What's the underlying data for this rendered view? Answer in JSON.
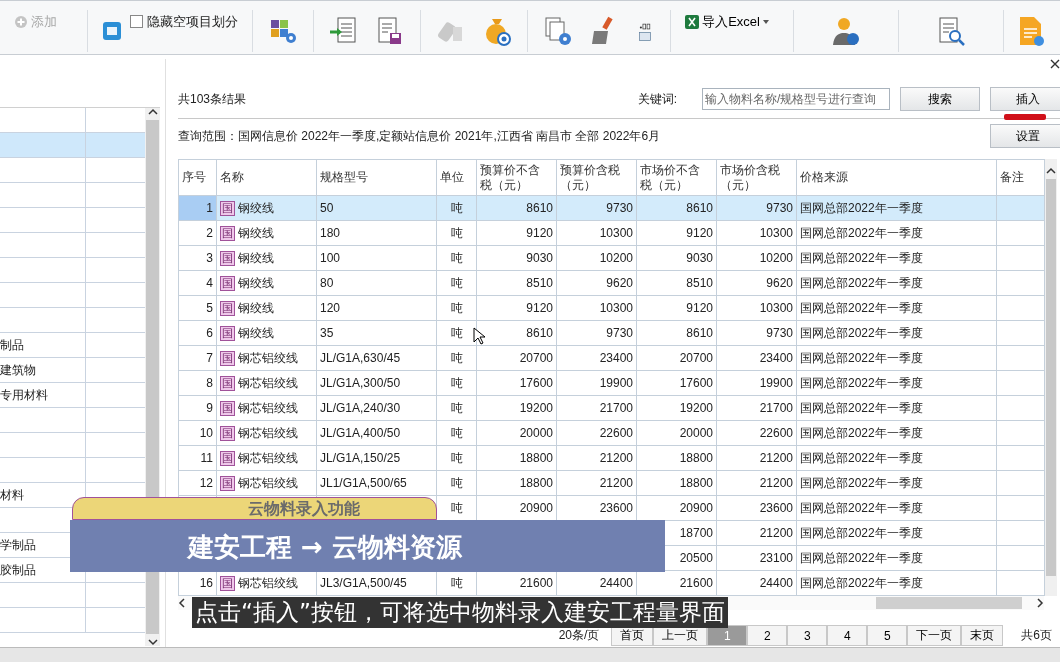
{
  "ribbon": {
    "add_button": {
      "label": "添加",
      "disabled": true
    },
    "hide_empty": {
      "label": "隐藏空项目划分",
      "checked": false
    },
    "import_excel": {
      "label": "导入Excel"
    }
  },
  "sidebar": {
    "rows": [
      {
        "selected": false
      },
      {
        "selected": true
      },
      {
        "selected": false
      },
      {
        "selected": false
      },
      {
        "selected": false
      },
      {
        "selected": false
      },
      {
        "selected": false
      },
      {
        "selected": false
      },
      {
        "selected": false
      },
      {
        "label": "制品",
        "selected": false
      },
      {
        "label": "建筑物",
        "selected": false
      },
      {
        "label": "专用材料",
        "selected": false
      },
      {
        "selected": false
      },
      {
        "selected": false
      },
      {
        "selected": false
      },
      {
        "label": "材料",
        "selected": false
      },
      {
        "selected": false
      },
      {
        "label": "学制品",
        "selected": false
      },
      {
        "label": "胶制品",
        "selected": false
      },
      {
        "selected": false
      },
      {
        "selected": false
      }
    ]
  },
  "dialog": {
    "result_count": "共103条结果",
    "keyword_label": "关键词:",
    "search_placeholder": "输入物料名称/规格型号进行查询",
    "search_button": "搜索",
    "insert_button": "插入",
    "settings_button": "设置",
    "query_scope": "查询范围：国网信息价 2022年一季度,定额站信息价 2021年,江西省 南昌市 全部 2022年6月",
    "table": {
      "columns": [
        "序号",
        "名称",
        "规格型号",
        "单位",
        "预算价不含税（元）",
        "预算价含税（元）",
        "市场价不含税（元）",
        "市场价含税（元）",
        "价格来源",
        "备注"
      ],
      "rows": [
        {
          "no": "1",
          "tag": "国",
          "name": "钢绞线",
          "spec": "50",
          "unit": "吨",
          "budget_ex_tax": "8610",
          "budget_inc_tax": "9730",
          "market_ex_tax": "8610",
          "market_inc_tax": "9730",
          "source": "国网总部2022年一季度",
          "selected": true
        },
        {
          "no": "2",
          "tag": "国",
          "name": "钢绞线",
          "spec": "180",
          "unit": "吨",
          "budget_ex_tax": "9120",
          "budget_inc_tax": "10300",
          "market_ex_tax": "9120",
          "market_inc_tax": "10300",
          "source": "国网总部2022年一季度",
          "selected": false
        },
        {
          "no": "3",
          "tag": "国",
          "name": "钢绞线",
          "spec": "100",
          "unit": "吨",
          "budget_ex_tax": "9030",
          "budget_inc_tax": "10200",
          "market_ex_tax": "9030",
          "market_inc_tax": "10200",
          "source": "国网总部2022年一季度",
          "selected": false
        },
        {
          "no": "4",
          "tag": "国",
          "name": "钢绞线",
          "spec": "80",
          "unit": "吨",
          "budget_ex_tax": "8510",
          "budget_inc_tax": "9620",
          "market_ex_tax": "8510",
          "market_inc_tax": "9620",
          "source": "国网总部2022年一季度",
          "selected": false
        },
        {
          "no": "5",
          "tag": "国",
          "name": "钢绞线",
          "spec": "120",
          "unit": "吨",
          "budget_ex_tax": "9120",
          "budget_inc_tax": "10300",
          "market_ex_tax": "9120",
          "market_inc_tax": "10300",
          "source": "国网总部2022年一季度",
          "selected": false
        },
        {
          "no": "6",
          "tag": "国",
          "name": "钢绞线",
          "spec": "35",
          "unit": "吨",
          "budget_ex_tax": "8610",
          "budget_inc_tax": "9730",
          "market_ex_tax": "8610",
          "market_inc_tax": "9730",
          "source": "国网总部2022年一季度",
          "selected": false
        },
        {
          "no": "7",
          "tag": "国",
          "name": "钢芯铝绞线",
          "spec": "JL/G1A,630/45",
          "unit": "吨",
          "budget_ex_tax": "20700",
          "budget_inc_tax": "23400",
          "market_ex_tax": "20700",
          "market_inc_tax": "23400",
          "source": "国网总部2022年一季度",
          "selected": false
        },
        {
          "no": "8",
          "tag": "国",
          "name": "钢芯铝绞线",
          "spec": "JL/G1A,300/50",
          "unit": "吨",
          "budget_ex_tax": "17600",
          "budget_inc_tax": "19900",
          "market_ex_tax": "17600",
          "market_inc_tax": "19900",
          "source": "国网总部2022年一季度",
          "selected": false
        },
        {
          "no": "9",
          "tag": "国",
          "name": "钢芯铝绞线",
          "spec": "JL/G1A,240/30",
          "unit": "吨",
          "budget_ex_tax": "19200",
          "budget_inc_tax": "21700",
          "market_ex_tax": "19200",
          "market_inc_tax": "21700",
          "source": "国网总部2022年一季度",
          "selected": false
        },
        {
          "no": "10",
          "tag": "国",
          "name": "钢芯铝绞线",
          "spec": "JL/G1A,400/50",
          "unit": "吨",
          "budget_ex_tax": "20000",
          "budget_inc_tax": "22600",
          "market_ex_tax": "20000",
          "market_inc_tax": "22600",
          "source": "国网总部2022年一季度",
          "selected": false
        },
        {
          "no": "11",
          "tag": "国",
          "name": "钢芯铝绞线",
          "spec": "JL/G1A,150/25",
          "unit": "吨",
          "budget_ex_tax": "18800",
          "budget_inc_tax": "21200",
          "market_ex_tax": "18800",
          "market_inc_tax": "21200",
          "source": "国网总部2022年一季度",
          "selected": false
        },
        {
          "no": "12",
          "tag": "国",
          "name": "钢芯铝绞线",
          "spec": "JL1/G1A,500/65",
          "unit": "吨",
          "budget_ex_tax": "18800",
          "budget_inc_tax": "21200",
          "market_ex_tax": "18800",
          "market_inc_tax": "21200",
          "source": "国网总部2022年一季度",
          "selected": false
        },
        {
          "unit": "吨",
          "budget_ex_tax": "20900",
          "budget_inc_tax": "23600",
          "market_ex_tax": "20900",
          "market_inc_tax": "23600",
          "source": "国网总部2022年一季度",
          "selected": false
        },
        {
          "market_ex_tax": "18700",
          "market_inc_tax": "21200",
          "source": "国网总部2022年一季度",
          "selected": false
        },
        {
          "market_ex_tax": "20500",
          "market_inc_tax": "23100",
          "source": "国网总部2022年一季度",
          "selected": false
        },
        {
          "no": "16",
          "tag": "国",
          "name": "钢芯铝绞线",
          "spec": "JL3/G1A,500/45",
          "unit": "吨",
          "budget_ex_tax": "21600",
          "budget_inc_tax": "24400",
          "market_ex_tax": "21600",
          "market_inc_tax": "24400",
          "source": "国网总部2022年一季度",
          "selected": false
        }
      ]
    },
    "pagination": {
      "page_size": "20条/页",
      "pages": [
        {
          "label": "首页",
          "selected": false
        },
        {
          "label": "上一页",
          "selected": false
        },
        {
          "label": "1",
          "selected": true
        },
        {
          "label": "2",
          "selected": false
        },
        {
          "label": "3",
          "selected": false
        },
        {
          "label": "4",
          "selected": false
        },
        {
          "label": "5",
          "selected": false
        },
        {
          "label": "下一页",
          "selected": false
        },
        {
          "label": "末页",
          "selected": false
        }
      ],
      "total_pages": "共6页"
    }
  },
  "captions": [
    {
      "kind": "tag",
      "text": "云物料录入功能"
    },
    {
      "kind": "band",
      "text": "建安工程 → 云物料资源"
    },
    {
      "kind": "subtitle",
      "text": "点击“插入”按钮，可将选中物料录入建安工程量界面"
    }
  ]
}
